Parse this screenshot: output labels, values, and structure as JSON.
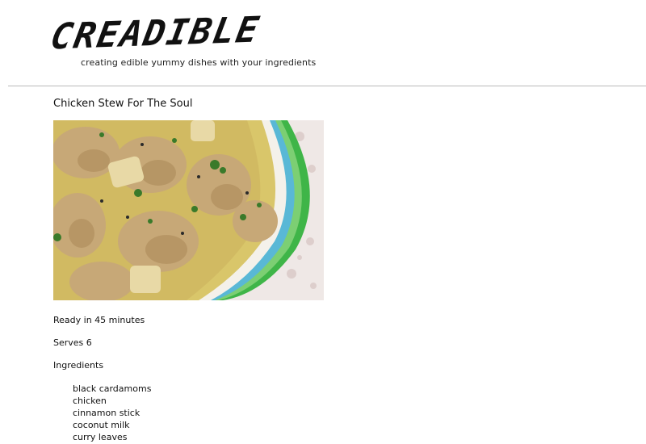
{
  "header": {
    "brand": "CREADIBLE",
    "tagline": "creating edible yummy dishes with your ingredients"
  },
  "recipe": {
    "title": "Chicken Stew For The Soul",
    "ready_text": "Ready in 45 minutes",
    "serves_text": "Serves 6",
    "ingredients_heading": "Ingredients",
    "ingredients": [
      "black cardamoms",
      "chicken",
      "cinnamon stick",
      "coconut milk",
      "curry leaves"
    ]
  },
  "colors": {
    "text": "#111111",
    "divider": "#b9b9b9",
    "background": "#ffffff"
  }
}
